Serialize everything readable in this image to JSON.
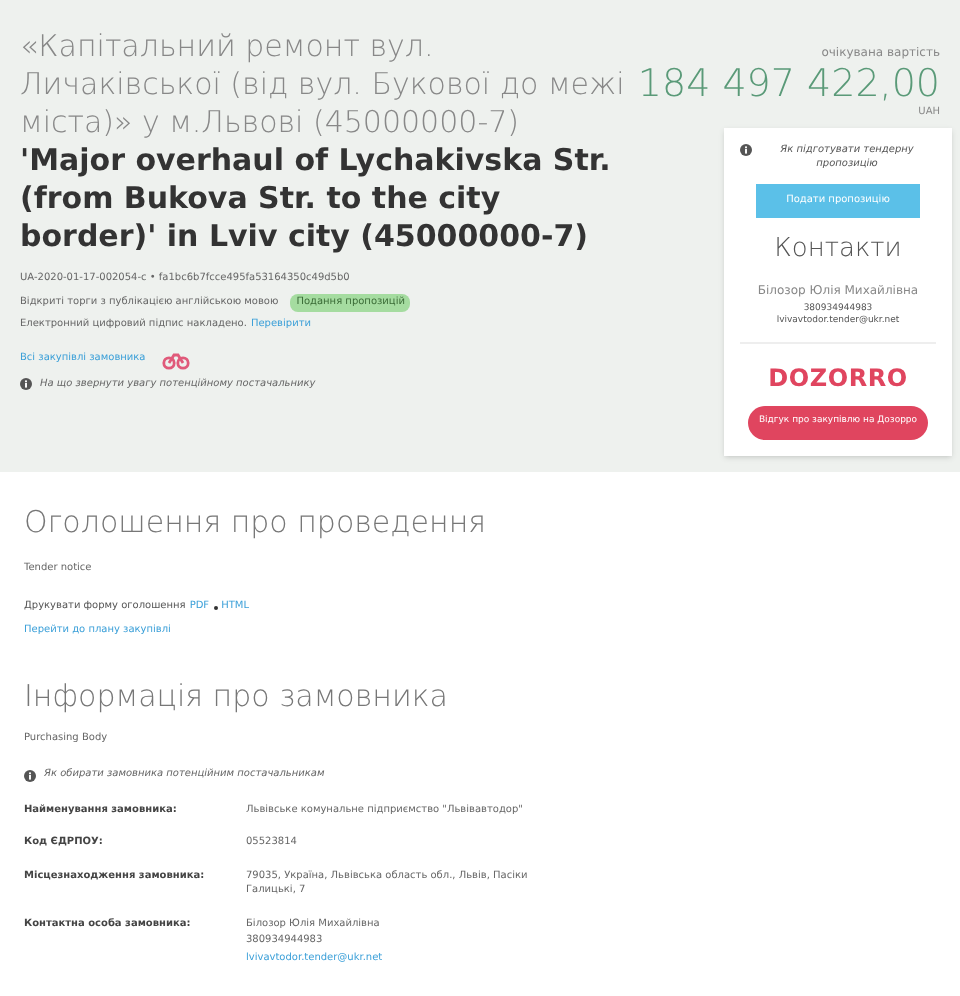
{
  "title_uk": "«Капітальний ремонт вул. Личаківської (від вул. Букової до межі міста)» у м.Львові (45000000-7)",
  "title_en": "'Major overhaul of Lychakivska Str. (from Bukova Str. to the city border)' in Lviv city (45000000-7)",
  "tender_id": "UA-2020-01-17-002054-c • fa1bc6b7fcce495fa53164350c49d5b0",
  "english_note": "Відкриті торги з публікацією англійською мовою",
  "status_badge": "Подання пропозицій",
  "signature_text": "Електронний цифровий підпис накладено.",
  "signature_link": "Перевірити",
  "all_purchases_link": "Всі закупівлі замовника",
  "attention_note": "На що звернути увагу потенційному постачальнику",
  "value_caption": "очікувана вартість",
  "value_amount": "184 497 422,00",
  "value_currency": "UAH",
  "how_to_prepare": "Як підготувати тендерну пропозицію",
  "submit_button": "Подати пропозицію",
  "contacts_title": "Контакти",
  "contact_name": "Білозор Юлія Михайлівна",
  "contact_phone": "380934944983",
  "contact_email": "lvivavtodor.tender@ukr.net",
  "dozorro_logo": "DOZORRO",
  "dozorro_button": "Відгук про закупівлю на Дозорро",
  "notice_title": "Оголошення про проведення",
  "notice_subtitle": "Tender notice",
  "print_label": "Друкувати форму оголошення",
  "print_pdf": "PDF",
  "print_html": "HTML",
  "plan_link": "Перейти до плану закупівлі",
  "buyer_title": "Інформація про замовника",
  "buyer_subtitle": "Purchasing Body",
  "buyer_note": "Як обирати замовника потенційним постачальникам",
  "buyer_rows": [
    {
      "label": "Найменування замовника:",
      "lines": [
        "Львівське комунальне підприємство \"Львівавтодор\""
      ]
    },
    {
      "label": "Код ЄДРПОУ:",
      "lines": [
        "05523814"
      ]
    },
    {
      "label": "Місцезнаходження замовника:",
      "lines": [
        "79035, Україна, Львівська область обл., Львів, Пасіки Галицькі, 7"
      ]
    },
    {
      "label": "Контактна особа замовника:",
      "lines": [
        "Білозор Юлія Михайлівна",
        "380934944983"
      ],
      "link": "lvivavtodor.tender@ukr.net"
    }
  ]
}
